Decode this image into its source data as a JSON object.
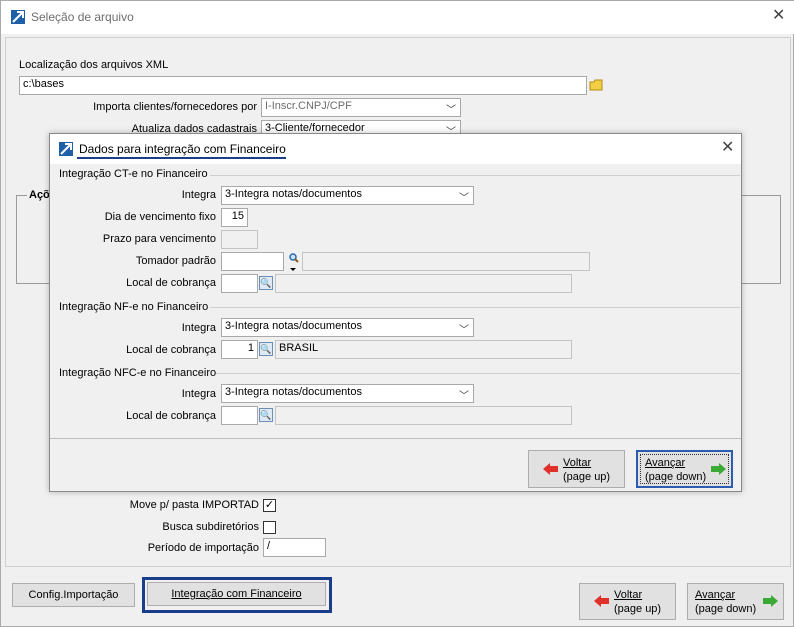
{
  "window": {
    "title": "Seleção de arquivo"
  },
  "main": {
    "xml_location_label": "Localização dos arquivos XML",
    "xml_location_value": "c:\\bases",
    "import_by_label": "Importa clientes/fornecedores por",
    "import_by_value": "I-Inscr.CNPJ/CPF",
    "update_label": "Atualiza dados cadastrais",
    "update_value": "3-Cliente/fornecedor",
    "actions_group_label": "Açõ",
    "move_label": "Move p/ pasta IMPORTAD",
    "move_checked": true,
    "subdirs_label": "Busca subdiretórios",
    "subdirs_checked": false,
    "period_label": "Período de importação",
    "period_value": "/",
    "config_button": "Config.Importação",
    "integration_button": "Integração com Financeiro",
    "back_line1": "Voltar",
    "back_line2": "(page up)",
    "next_line1": "Avançar",
    "next_line2": "(page down)"
  },
  "dialog": {
    "title": "Dados para integração com Financeiro",
    "cte": {
      "group_label": "Integração CT-e no Financeiro",
      "integra_label": "Integra",
      "integra_value": "3-Integra notas/documentos",
      "due_day_label": "Dia de vencimento fixo",
      "due_day_value": "15",
      "term_label": "Prazo para vencimento",
      "term_value": "",
      "payer_label": "Tomador padrão",
      "payer_value": "",
      "billing_label": "Local de cobrança",
      "billing_code": "",
      "billing_name": ""
    },
    "nfe": {
      "group_label": "Integração NF-e no Financeiro",
      "integra_label": "Integra",
      "integra_value": "3-Integra notas/documentos",
      "billing_label": "Local de cobrança",
      "billing_code": "1",
      "billing_name": "BRASIL"
    },
    "nfce": {
      "group_label": "Integração NFC-e no Financeiro",
      "integra_label": "Integra",
      "integra_value": "3-Integra notas/documentos",
      "billing_label": "Local de cobrança",
      "billing_code": "",
      "billing_name": ""
    },
    "back_line1": "Voltar",
    "back_line2": "(page up)",
    "next_line1": "Avançar",
    "next_line2": "(page down)"
  },
  "colors": {
    "highlight_border": "#1a3f8a",
    "title_underline": "#1a3f8a",
    "back_arrow": "#e0302a",
    "next_arrow": "#3aaa35"
  }
}
